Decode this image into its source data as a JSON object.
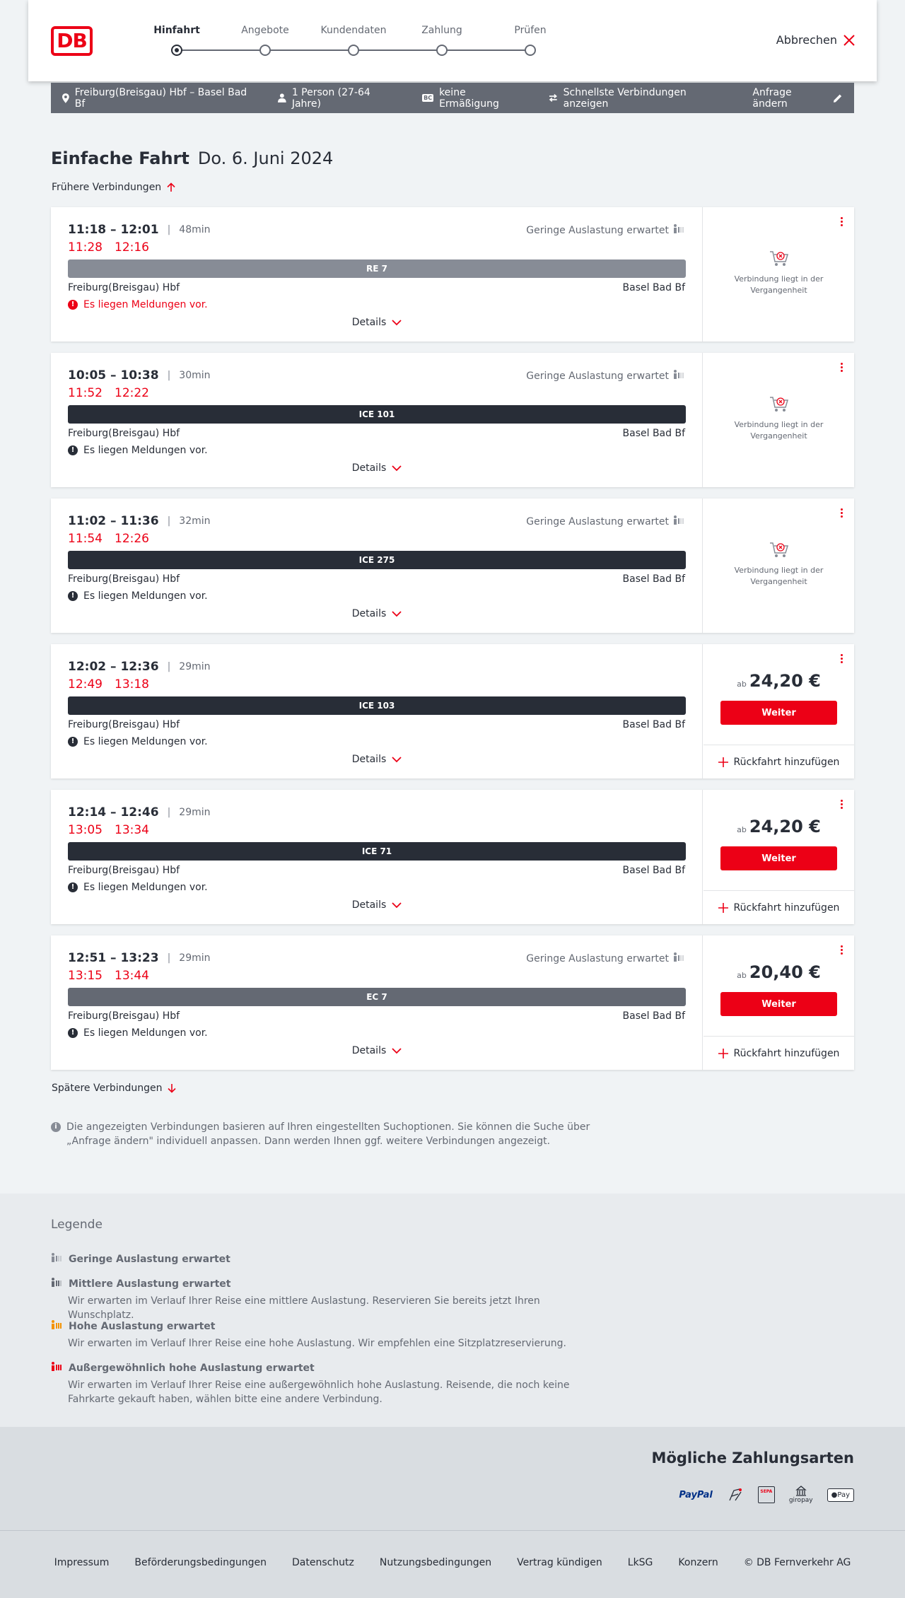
{
  "header": {
    "logo": "DB",
    "steps": [
      "Hinfahrt",
      "Angebote",
      "Kundendaten",
      "Zahlung",
      "Prüfen"
    ],
    "active_step": 0,
    "cancel_label": "Abbrechen"
  },
  "query": {
    "route": "Freiburg(Breisgau) Hbf – Basel Bad Bf",
    "passengers": "1 Person (27-64 Jahre)",
    "discount_badge": "BC",
    "discount": "keine Ermäßigung",
    "fastest": "Schnellste Verbindungen anzeigen",
    "change": "Anfrage ändern"
  },
  "title": {
    "trip_type": "Einfache Fahrt",
    "date": "Do. 6. Juni 2024"
  },
  "earlier_label": "Frühere Verbindungen",
  "later_label": "Spätere Verbindungen",
  "connections": [
    {
      "time": "11:18 – 12:01",
      "duration": "48min",
      "rt_dep": "11:28",
      "rt_arr": "12:16",
      "occupancy": "Geringe Auslastung erwartet",
      "train": "RE 7",
      "train_color": "#878c96",
      "from": "Freiburg(Breisgau) Hbf",
      "to": "Basel Bad Bf",
      "message": "Es liegen Meldungen vor.",
      "message_color": "#ec0016",
      "details": "Details",
      "status": "past",
      "past_text": "Verbindung liegt in der Vergangenheit"
    },
    {
      "time": "10:05 – 10:38",
      "duration": "30min",
      "rt_dep": "11:52",
      "rt_arr": "12:22",
      "occupancy": "Geringe Auslastung erwartet",
      "train": "ICE 101",
      "train_color": "#282d37",
      "from": "Freiburg(Breisgau) Hbf",
      "to": "Basel Bad Bf",
      "message": "Es liegen Meldungen vor.",
      "message_color": "#282d37",
      "details": "Details",
      "status": "past",
      "past_text": "Verbindung liegt in der Vergangenheit"
    },
    {
      "time": "11:02 – 11:36",
      "duration": "32min",
      "rt_dep": "11:54",
      "rt_arr": "12:26",
      "occupancy": "Geringe Auslastung erwartet",
      "train": "ICE 275",
      "train_color": "#282d37",
      "from": "Freiburg(Breisgau) Hbf",
      "to": "Basel Bad Bf",
      "message": "Es liegen Meldungen vor.",
      "message_color": "#282d37",
      "details": "Details",
      "status": "past",
      "past_text": "Verbindung liegt in der Vergangenheit"
    },
    {
      "time": "12:02 – 12:36",
      "duration": "29min",
      "rt_dep": "12:49",
      "rt_arr": "13:18",
      "occupancy": "",
      "train": "ICE 103",
      "train_color": "#282d37",
      "from": "Freiburg(Breisgau) Hbf",
      "to": "Basel Bad Bf",
      "message": "Es liegen Meldungen vor.",
      "message_color": "#282d37",
      "details": "Details",
      "status": "bookable",
      "price_prefix": "ab",
      "price": "24,20 €",
      "button": "Weiter",
      "return_label": "Rückfahrt hinzufügen"
    },
    {
      "time": "12:14 – 12:46",
      "duration": "29min",
      "rt_dep": "13:05",
      "rt_arr": "13:34",
      "occupancy": "",
      "train": "ICE 71",
      "train_color": "#282d37",
      "from": "Freiburg(Breisgau) Hbf",
      "to": "Basel Bad Bf",
      "message": "Es liegen Meldungen vor.",
      "message_color": "#282d37",
      "details": "Details",
      "status": "bookable",
      "price_prefix": "ab",
      "price": "24,20 €",
      "button": "Weiter",
      "return_label": "Rückfahrt hinzufügen"
    },
    {
      "time": "12:51 – 13:23",
      "duration": "29min",
      "rt_dep": "13:15",
      "rt_arr": "13:44",
      "occupancy": "Geringe Auslastung erwartet",
      "train": "EC 7",
      "train_color": "#646973",
      "from": "Freiburg(Breisgau) Hbf",
      "to": "Basel Bad Bf",
      "message": "Es liegen Meldungen vor.",
      "message_color": "#282d37",
      "details": "Details",
      "status": "bookable",
      "price_prefix": "ab",
      "price": "20,40 €",
      "button": "Weiter",
      "return_label": "Rückfahrt hinzufügen"
    }
  ],
  "info_text": "Die angezeigten Verbindungen basieren auf Ihren eingestellten Suchoptionen. Sie können die Suche über „Anfrage ändern\" individuell anpassen. Dann werden Ihnen ggf. weitere Verbindungen angezeigt.",
  "legend": {
    "title": "Legende",
    "items": [
      {
        "label": "Geringe Auslastung erwartet",
        "desc": "",
        "color": "#878c96",
        "level": 1
      },
      {
        "label": "Mittlere Auslastung erwartet",
        "desc": "Wir erwarten im Verlauf Ihrer Reise eine mittlere Auslastung. Reservieren Sie bereits jetzt Ihren Wunschplatz.",
        "color": "#646973",
        "level": 2
      },
      {
        "label": "Hohe Auslastung erwartet",
        "desc": "Wir erwarten im Verlauf Ihrer Reise eine hohe Auslastung. Wir empfehlen eine Sitzplatzreservierung.",
        "color": "#f39200",
        "level": 3
      },
      {
        "label": "Außergewöhnlich hohe Auslastung erwartet",
        "desc": "Wir erwarten im Verlauf Ihrer Reise eine außergewöhnlich hohe Auslastung. Reisende, die noch keine Fahrkarte gekauft haben, wählen bitte eine andere Verbindung.",
        "color": "#ec0016",
        "level": 4
      }
    ]
  },
  "payments": {
    "title": "Mögliche Zahlungsarten",
    "methods": [
      "PayPal",
      "credit-card-icon",
      "SEPA",
      "giropay",
      "Pay"
    ]
  },
  "footer": {
    "links": [
      "Impressum",
      "Beförderungsbedingungen",
      "Datenschutz",
      "Nutzungsbedingungen",
      "Vertrag kündigen",
      "LkSG",
      "Konzern",
      "© DB Fernverkehr AG"
    ]
  },
  "colors": {
    "brand": "#ec0016",
    "text": "#282d37",
    "muted": "#646973",
    "background": "#f0f3f5"
  }
}
